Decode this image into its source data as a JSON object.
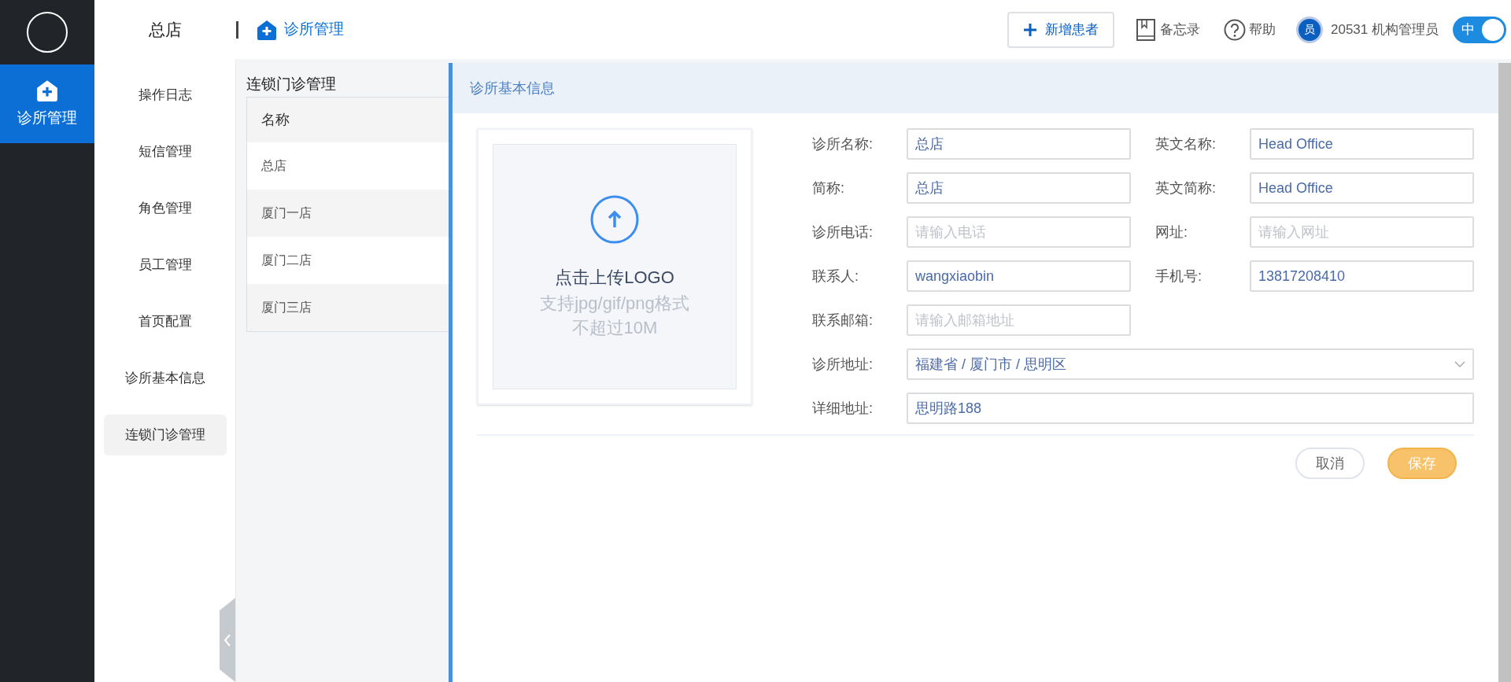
{
  "rail": {
    "items": [
      {
        "label": "诊所管理",
        "selected": true
      }
    ]
  },
  "topbar": {
    "store": "总店",
    "breadcrumb": "诊所管理",
    "add_button": "新增患者",
    "memo": "备忘录",
    "help": "帮助",
    "user_badge": "员",
    "user": "20531 机构管理员",
    "language_toggle": {
      "label": "中",
      "on": true
    }
  },
  "menu": [
    {
      "label": "操作日志",
      "selected": false
    },
    {
      "label": "短信管理",
      "selected": false
    },
    {
      "label": "角色管理",
      "selected": false
    },
    {
      "label": "员工管理",
      "selected": false
    },
    {
      "label": "首页配置",
      "selected": false
    },
    {
      "label": "诊所基本信息",
      "selected": false
    },
    {
      "label": "连锁门诊管理",
      "selected": true
    }
  ],
  "list": {
    "title": "连锁门诊管理",
    "column": "名称",
    "rows": [
      {
        "name": "总店"
      },
      {
        "name": "厦门一店"
      },
      {
        "name": "厦门二店"
      },
      {
        "name": "厦门三店"
      }
    ]
  },
  "form": {
    "title": "诊所基本信息",
    "upload": {
      "title": "点击上传LOGO",
      "hint": "支持jpg/gif/png格式",
      "limit": "不超过10M"
    },
    "rows": [
      [
        {
          "label": "诊所名称:",
          "value": "总店",
          "kind": "text"
        },
        {
          "label": "英文名称:",
          "value": "Head Office",
          "kind": "text"
        }
      ],
      [
        {
          "label": "简称:",
          "value": "总店",
          "kind": "text"
        },
        {
          "label": "英文简称:",
          "value": "Head Office",
          "kind": "text"
        }
      ],
      [
        {
          "label": "诊所电话:",
          "placeholder": "请输入电话",
          "kind": "text"
        },
        {
          "label": "网址:",
          "placeholder": "请输入网址",
          "kind": "text"
        }
      ],
      [
        {
          "label": "联系人:",
          "value": "wangxiaobin",
          "kind": "text"
        },
        {
          "label": "手机号:",
          "value": "13817208410",
          "kind": "text"
        }
      ],
      [
        {
          "label": "联系邮箱:",
          "placeholder": "请输入邮箱地址",
          "kind": "text"
        }
      ],
      [
        {
          "label": "诊所地址:",
          "value": "福建省 / 厦门市 / 思明区",
          "kind": "select",
          "wide": true
        }
      ],
      [
        {
          "label": "详细地址:",
          "value": "思明路188",
          "kind": "text",
          "wide": true
        }
      ]
    ],
    "buttons": [
      {
        "label": "取消",
        "kind": "secondary"
      },
      {
        "label": "保存",
        "kind": "primary"
      }
    ]
  }
}
